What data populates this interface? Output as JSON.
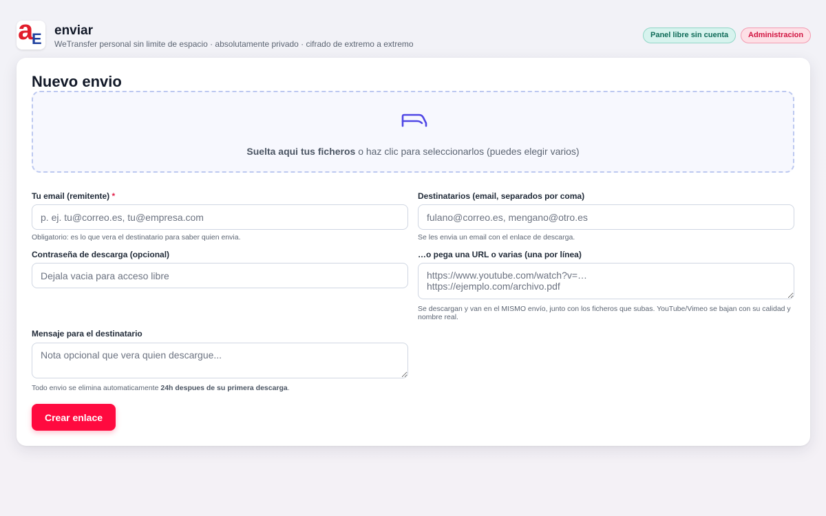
{
  "header": {
    "title": "enviar",
    "subtitle": "WeTransfer personal sin limite de espacio · absolutamente privado · cifrado de extremo a extremo",
    "logo_letters": [
      "a",
      "E"
    ],
    "badges": {
      "free_panel": "Panel libre sin cuenta",
      "admin": "Administracion"
    }
  },
  "form": {
    "title": "Nuevo envio",
    "dropzone": {
      "icon": "file-tray-icon",
      "text_bold": "Suelta aqui tus ficheros",
      "text_rest": " o haz clic para seleccionarlos (puedes elegir varios)"
    },
    "email": {
      "label": "Tu email (remitente)",
      "required_mark": "*",
      "placeholder": "p. ej. tu@correo.es, tu@empresa.com",
      "help": "Obligatorio: es lo que vera el destinatario para saber quien envia."
    },
    "recipients": {
      "label": "Destinatarios (email, separados por coma)",
      "placeholder": "fulano@correo.es, mengano@otro.es",
      "help": "Se les envia un email con el enlace de descarga."
    },
    "password": {
      "label": "Contraseña de descarga (opcional)",
      "placeholder": "Dejala vacia para acceso libre"
    },
    "urls": {
      "label": "…o pega una URL o varias (una por línea)",
      "placeholder": "https://www.youtube.com/watch?v=…\nhttps://ejemplo.com/archivo.pdf",
      "help": "Se descargan y van en el MISMO envío, junto con los ficheros que subas. YouTube/Vimeo se bajan con su calidad y nombre real."
    },
    "message": {
      "label": "Mensaje para el destinatario",
      "placeholder": "Nota opcional que vera quien descargue..."
    },
    "expiry_note": {
      "prefix": "Todo envio se elimina automaticamente ",
      "bold": "24h despues de su primera descarga",
      "suffix": "."
    },
    "submit_label": "Crear enlace"
  },
  "colors": {
    "accent": "#ff0a3f",
    "free_badge_bg": "#d7f3ee",
    "admin_badge_bg": "#fde0e6",
    "dropzone_border": "#bcc8f0",
    "icon": "#4f46e5"
  }
}
